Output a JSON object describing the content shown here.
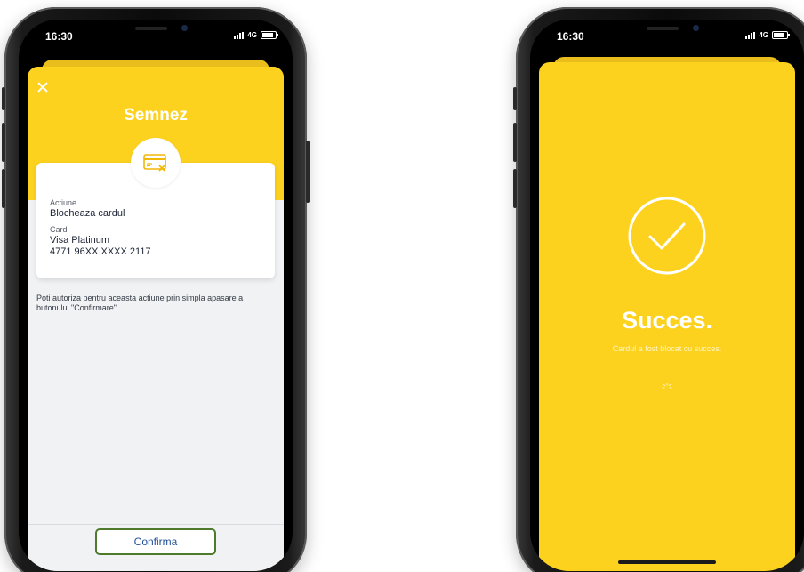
{
  "left_phone": {
    "status": {
      "time": "16:30",
      "network": "4G"
    },
    "sheet": {
      "title": "Semnez",
      "details": {
        "action_label": "Actiune",
        "action_value": "Blocheaza cardul",
        "card_label": "Card",
        "card_name": "Visa Platinum",
        "card_number": "4771 96XX XXXX 2117"
      },
      "info_text": "Poti autoriza pentru aceasta actiune prin simpla apasare a butonului \"Confirmare\".",
      "confirm_label": "Confirma"
    }
  },
  "right_phone": {
    "status": {
      "time": "16:30",
      "network": "4G"
    },
    "success": {
      "title": "Succes.",
      "subtitle": "Cardul a fost blocat cu succes."
    }
  },
  "colors": {
    "brand_yellow": "#fdd21f",
    "confirm_text": "#1f4f96",
    "confirm_border": "#4d7a2b"
  },
  "icons": [
    "close-icon",
    "card-blocked-icon",
    "check-circle-icon",
    "loading-spinner-icon",
    "signal-icon",
    "battery-icon"
  ]
}
